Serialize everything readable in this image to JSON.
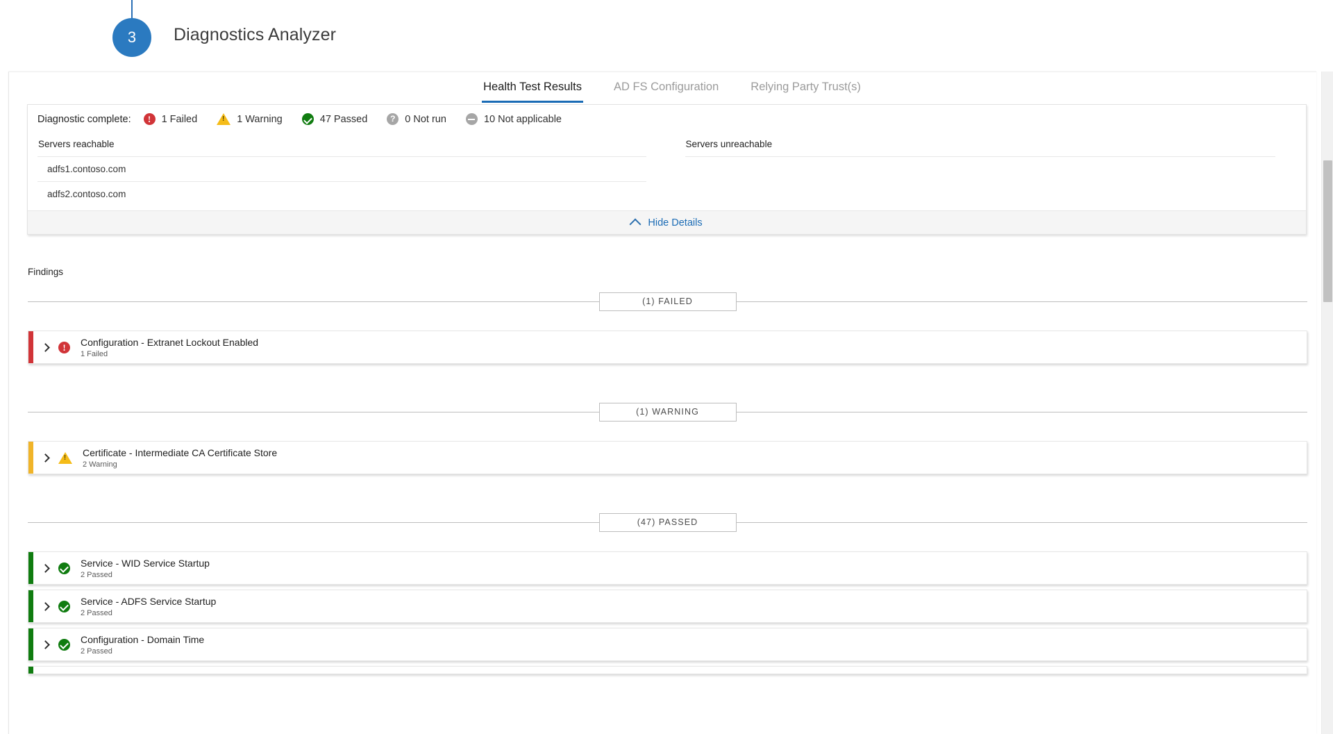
{
  "step": {
    "number": "3",
    "title": "Diagnostics Analyzer",
    "accent_color": "#2b7ac0"
  },
  "tabs": [
    {
      "label": "Health Test Results",
      "active": true
    },
    {
      "label": "AD FS Configuration",
      "active": false
    },
    {
      "label": "Relying Party Trust(s)",
      "active": false
    }
  ],
  "summary": {
    "label": "Diagnostic complete:",
    "stats": [
      {
        "icon": "error-icon",
        "text": "1 Failed",
        "color": "#d13438"
      },
      {
        "icon": "warning-icon",
        "text": "1 Warning",
        "color": "#f5bc18"
      },
      {
        "icon": "success-icon",
        "text": "47 Passed",
        "color": "#107c10"
      },
      {
        "icon": "question-icon",
        "text": "0 Not run",
        "color": "#a6a6a6"
      },
      {
        "icon": "not-applicable-icon",
        "text": "10 Not applicable",
        "color": "#a6a6a6"
      }
    ],
    "servers_reachable_title": "Servers reachable",
    "servers_reachable": [
      "adfs1.contoso.com",
      "adfs2.contoso.com"
    ],
    "servers_unreachable_title": "Servers unreachable",
    "servers_unreachable": [],
    "hide_details_label": "Hide Details"
  },
  "findings": {
    "label": "Findings",
    "sections": [
      {
        "chip": "(1) FAILED",
        "status": "failed",
        "items": [
          {
            "title": "Configuration - Extranet Lockout Enabled",
            "subtitle": "1 Failed"
          }
        ]
      },
      {
        "chip": "(1) WARNING",
        "status": "warning",
        "items": [
          {
            "title": "Certificate - Intermediate CA Certificate Store",
            "subtitle": "2 Warning"
          }
        ]
      },
      {
        "chip": "(47) PASSED",
        "status": "passed",
        "items": [
          {
            "title": "Service - WID Service Startup",
            "subtitle": "2 Passed"
          },
          {
            "title": "Service - ADFS Service Startup",
            "subtitle": "2 Passed"
          },
          {
            "title": "Configuration - Domain Time",
            "subtitle": "2 Passed"
          }
        ]
      }
    ]
  }
}
